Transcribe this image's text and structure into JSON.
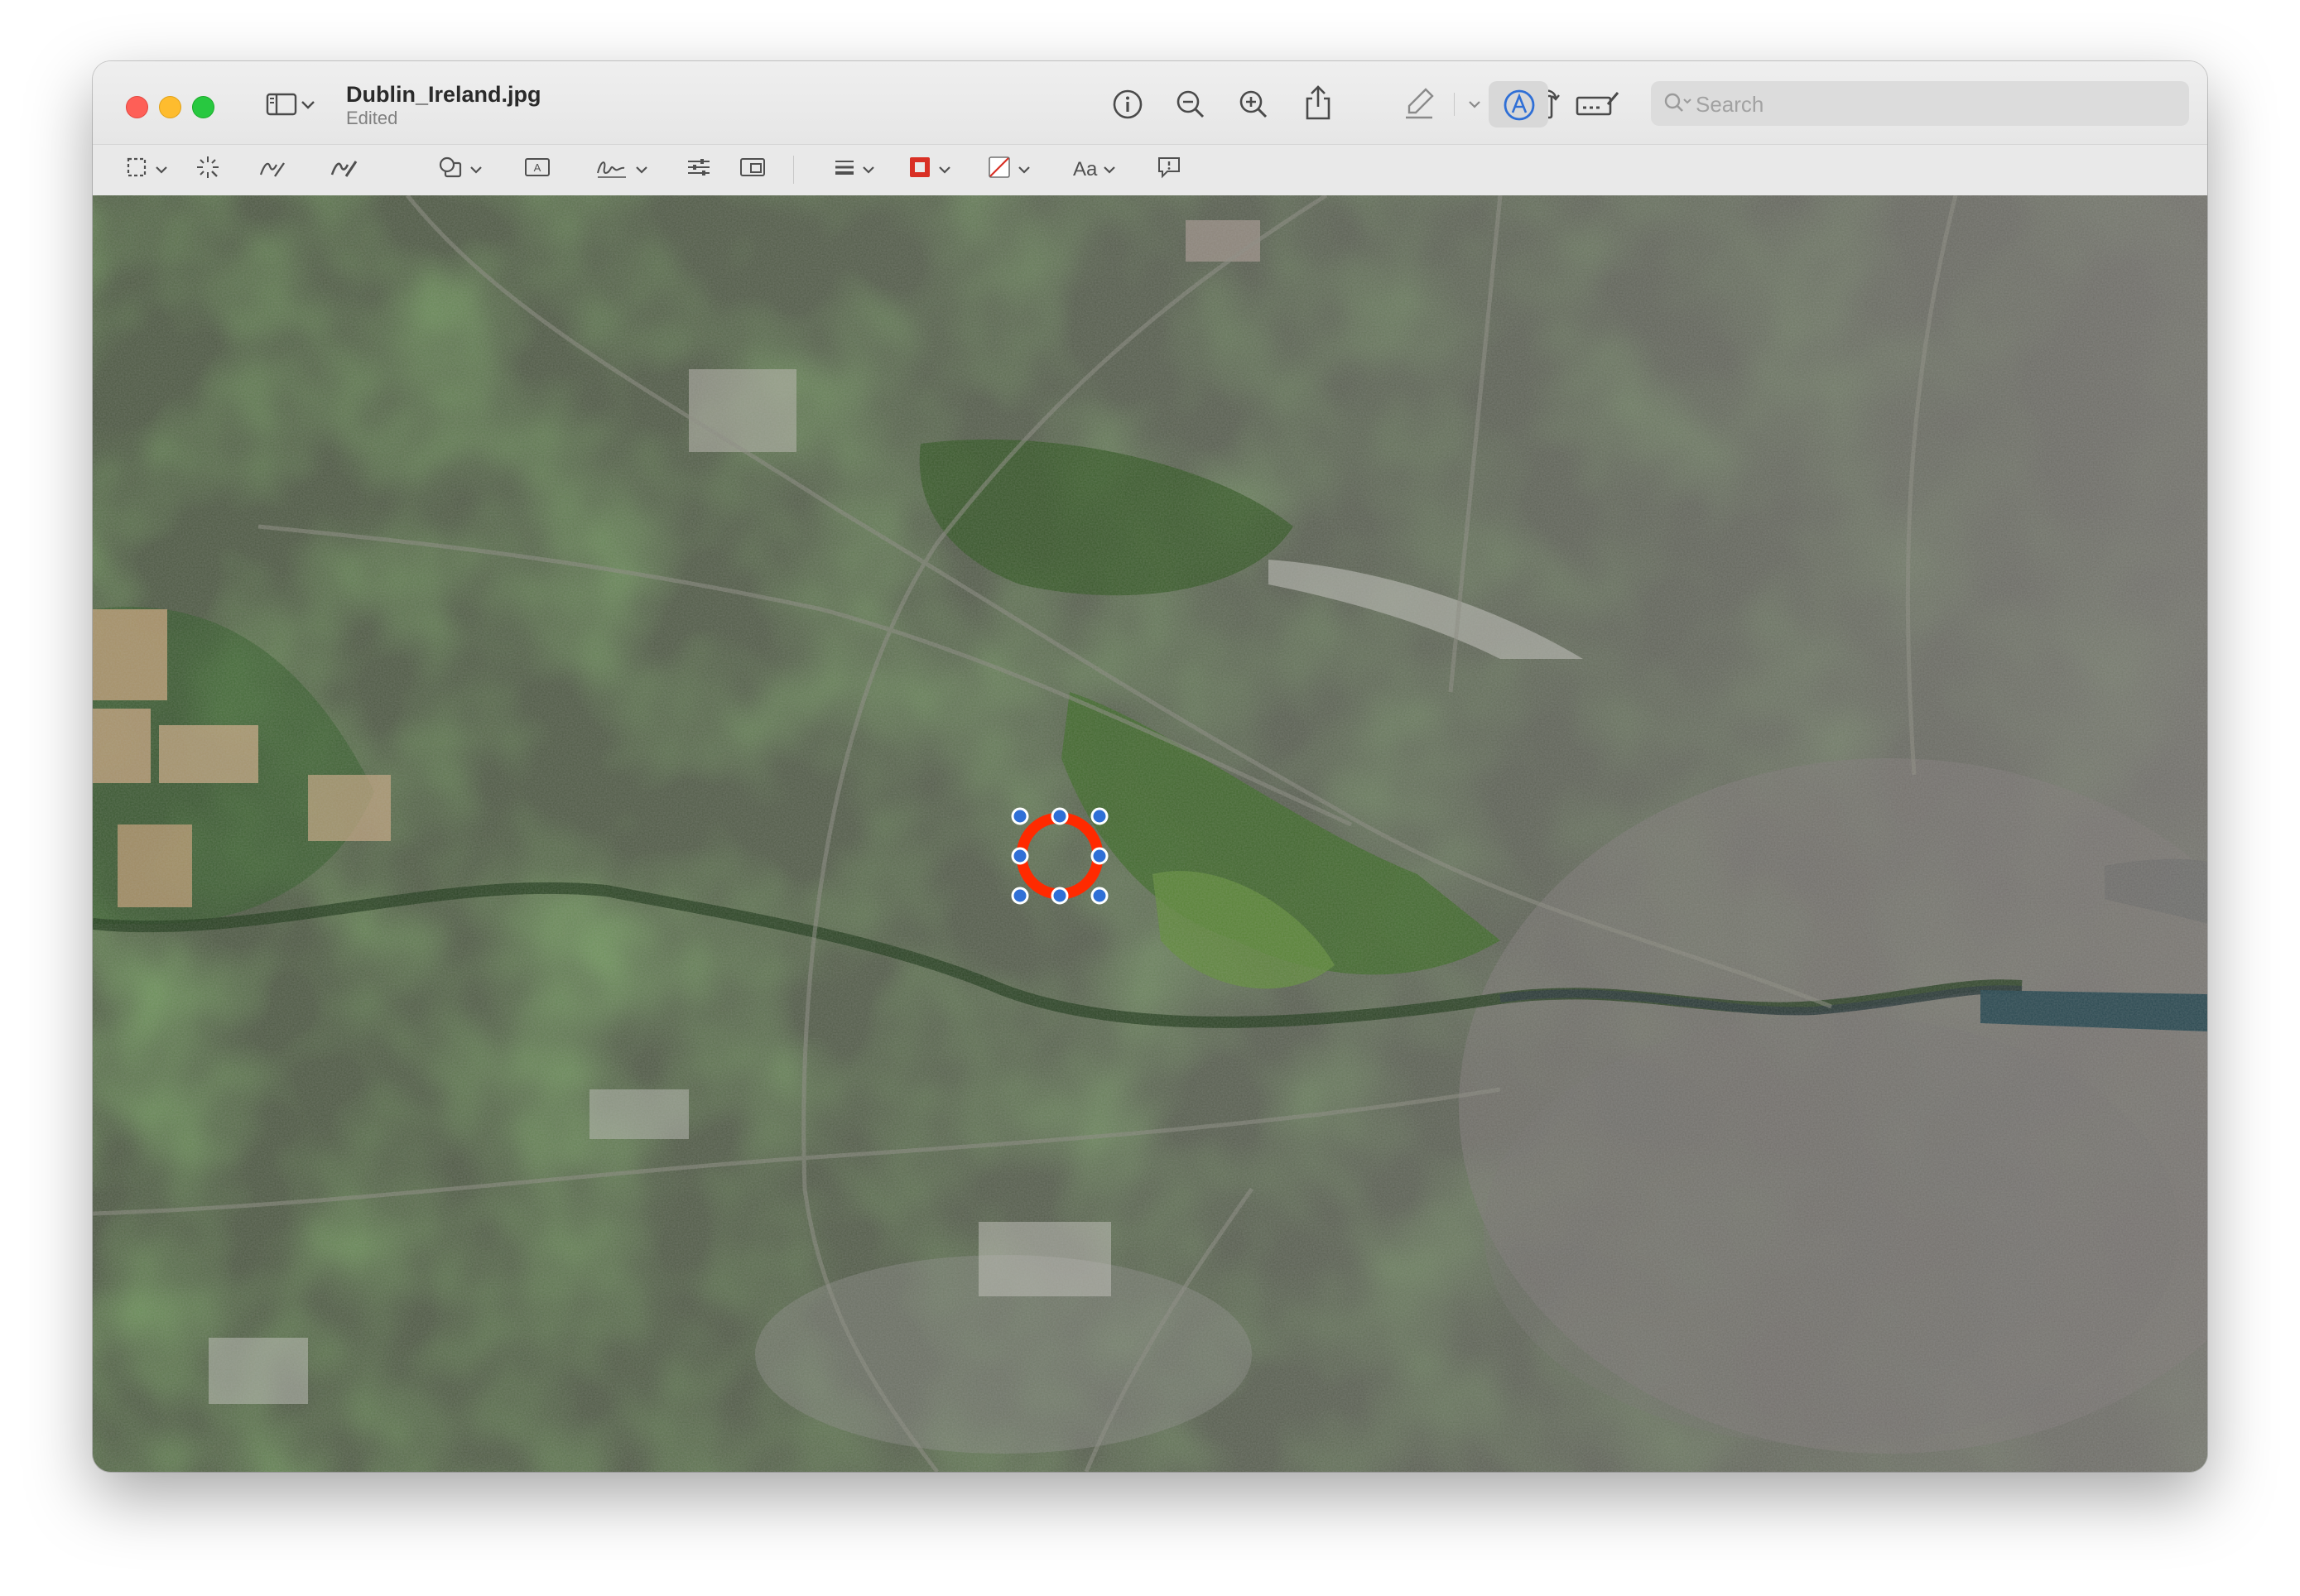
{
  "window": {
    "title": "Dublin_Ireland.jpg",
    "subtitle": "Edited"
  },
  "toolbar": {
    "buttons": [
      "sidebar-toggle",
      "info",
      "zoom-out",
      "zoom-in",
      "share",
      "highlight",
      "rotate",
      "markup",
      "crop"
    ],
    "search_placeholder": "Search"
  },
  "markup_toolbar": {
    "font_label": "Aa",
    "border_color": "#d93025",
    "fill_color": "none"
  },
  "annotation": {
    "shape": "circle",
    "stroke_color": "#ff2a00",
    "handle_color": "#2f6fd6"
  },
  "colors": {
    "accent": "#2f6fd6"
  }
}
